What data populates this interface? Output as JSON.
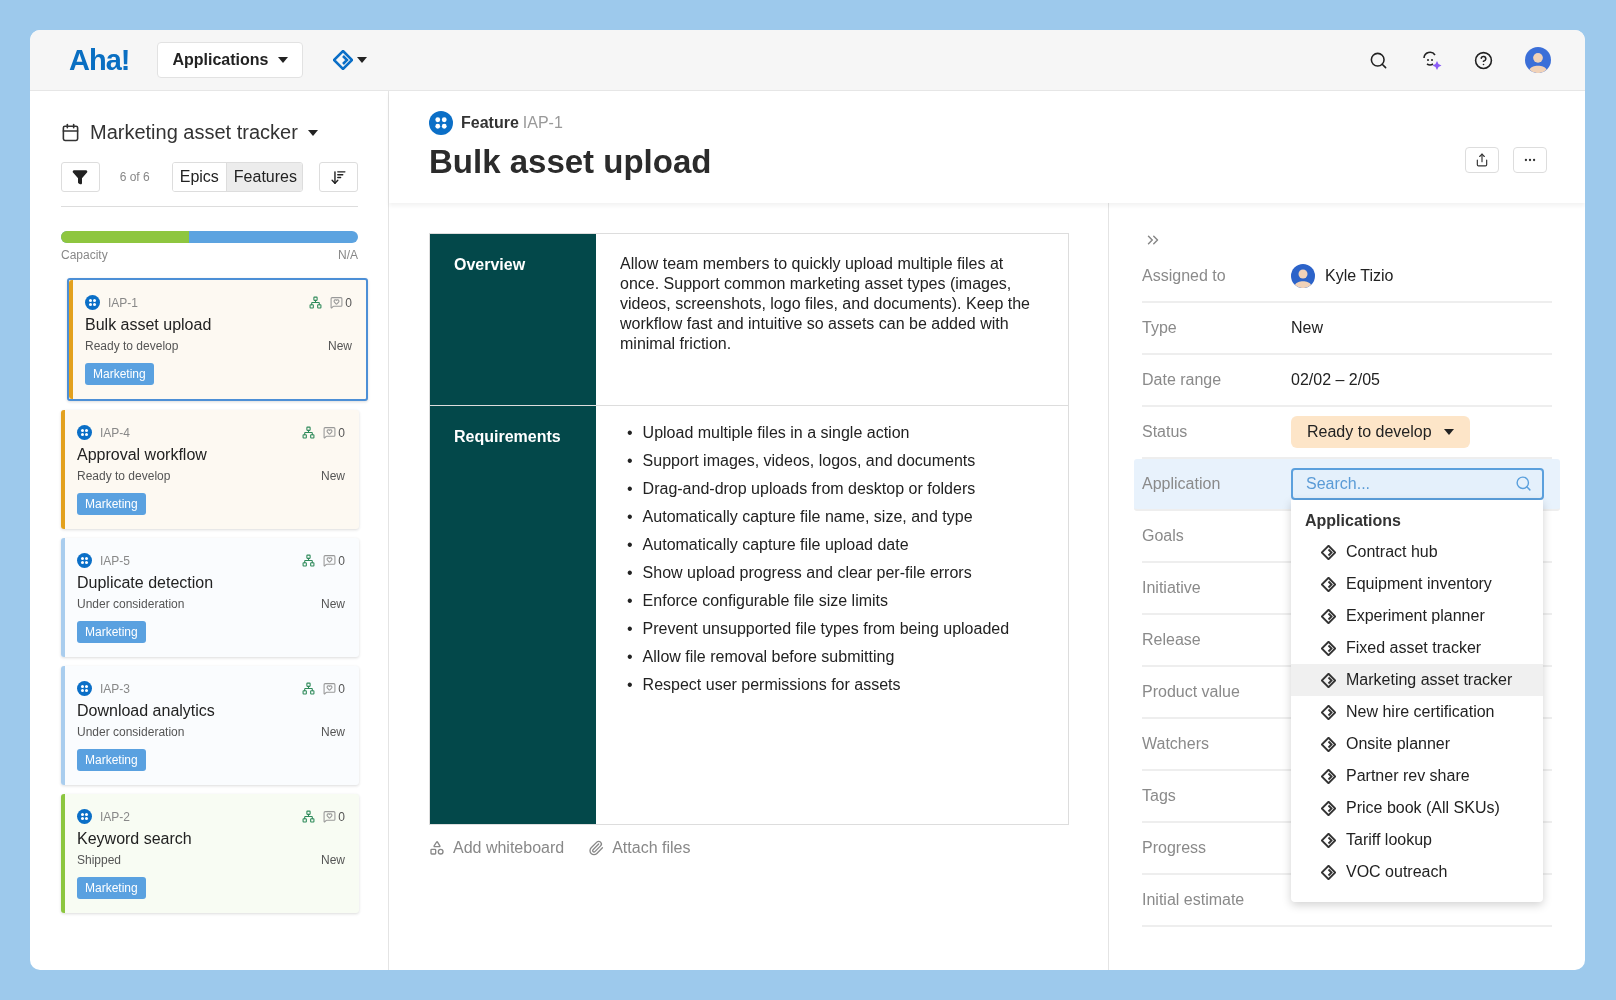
{
  "topbar": {
    "logo": "Aha!",
    "workspace": "Applications"
  },
  "sidebar": {
    "title": "Marketing asset tracker",
    "count": "6 of 6",
    "views": [
      {
        "label": "Epics",
        "selected": false
      },
      {
        "label": "Features",
        "selected": true
      }
    ],
    "capacity": {
      "label": "Capacity",
      "reading": "N/A",
      "level": 0.43
    },
    "cards": [
      {
        "id": "IAP-1",
        "title": "Bulk asset upload",
        "status": "Ready to develop",
        "type": "New",
        "comments": "0",
        "tag": "Marketing",
        "color": "#e3a11e",
        "selected": true
      },
      {
        "id": "IAP-4",
        "title": "Approval workflow",
        "status": "Ready to develop",
        "type": "New",
        "comments": "0",
        "tag": "Marketing",
        "color": "#e3a11e",
        "selected": false
      },
      {
        "id": "IAP-5",
        "title": "Duplicate detection",
        "status": "Under consideration",
        "type": "New",
        "comments": "0",
        "tag": "Marketing",
        "color": "#a9cdee",
        "selected": false
      },
      {
        "id": "IAP-3",
        "title": "Download analytics",
        "status": "Under consideration",
        "type": "New",
        "comments": "0",
        "tag": "Marketing",
        "color": "#a9cdee",
        "selected": false
      },
      {
        "id": "IAP-2",
        "title": "Keyword search",
        "status": "Shipped",
        "type": "New",
        "comments": "0",
        "tag": "Marketing",
        "color": "#8cc63f",
        "selected": false
      }
    ]
  },
  "record": {
    "kind_label": "Feature",
    "ref": "IAP-1",
    "title": "Bulk asset upload",
    "sections": [
      {
        "heading": "Overview",
        "kind": "paragraph",
        "text": "Allow team members to quickly upload multiple files at once. Support common marketing asset types (images, videos, screenshots, logo files, and documents). Keep the workflow fast and intuitive so assets can be added with minimal friction."
      },
      {
        "heading": "Requirements",
        "kind": "list",
        "bullet": "•",
        "items": [
          "Upload multiple files in a single action",
          "Support images, videos, logos, and documents",
          "Drag-and-drop uploads from desktop or folders",
          "Automatically capture file name, size, and type",
          "Automatically capture file upload date",
          "Show upload progress and clear per-file errors",
          "Enforce configurable file size limits",
          "Prevent unsupported file types from being uploaded",
          "Allow file removal before submitting",
          "Respect user permissions for assets"
        ]
      }
    ],
    "actions": [
      "Add whiteboard",
      "Attach files"
    ]
  },
  "details": {
    "fields": [
      {
        "label": "Assigned to",
        "kind": "person",
        "value": "Kyle Tizio",
        "selected": false
      },
      {
        "label": "Type",
        "kind": "text",
        "value": "New",
        "selected": false
      },
      {
        "label": "Date range",
        "kind": "text",
        "value": "02/02 – 2/05",
        "selected": false
      },
      {
        "label": "Status",
        "kind": "status",
        "value": "Ready to develop",
        "selected": false
      },
      {
        "label": "Application",
        "kind": "search",
        "placeholder": "Search...",
        "selected": true
      },
      {
        "label": "Goals",
        "kind": "empty",
        "selected": false
      },
      {
        "label": "Initiative",
        "kind": "empty",
        "selected": false
      },
      {
        "label": "Release",
        "kind": "empty",
        "selected": false
      },
      {
        "label": "Product value",
        "kind": "empty",
        "selected": false
      },
      {
        "label": "Watchers",
        "kind": "empty",
        "selected": false
      },
      {
        "label": "Tags",
        "kind": "empty",
        "selected": false
      },
      {
        "label": "Progress",
        "kind": "empty",
        "selected": false
      },
      {
        "label": "Initial estimate",
        "kind": "empty",
        "selected": false
      }
    ],
    "dropdown": {
      "heading": "Applications",
      "items": [
        {
          "label": "Contract hub",
          "selected": false
        },
        {
          "label": "Equipment inventory",
          "selected": false
        },
        {
          "label": "Experiment planner",
          "selected": false
        },
        {
          "label": "Fixed asset tracker",
          "selected": false
        },
        {
          "label": "Marketing asset tracker",
          "selected": true
        },
        {
          "label": "New hire certification",
          "selected": false
        },
        {
          "label": "Onsite planner",
          "selected": false
        },
        {
          "label": "Partner rev share",
          "selected": false
        },
        {
          "label": "Price book (All SKUs)",
          "selected": false
        },
        {
          "label": "Tariff lookup",
          "selected": false
        },
        {
          "label": "VOC outreach",
          "selected": false
        }
      ]
    }
  }
}
